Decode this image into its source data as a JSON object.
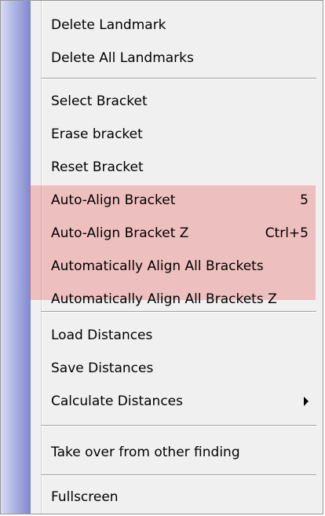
{
  "menu": {
    "items": [
      {
        "label": "Delete Landmark"
      },
      {
        "label": "Delete All Landmarks"
      },
      {
        "label": "Select Bracket"
      },
      {
        "label": "Erase bracket"
      },
      {
        "label": "Reset Bracket"
      },
      {
        "label": "Auto-Align Bracket",
        "shortcut": "5"
      },
      {
        "label": "Auto-Align Bracket Z",
        "shortcut": "Ctrl+5"
      },
      {
        "label": "Automatically Align All Brackets"
      },
      {
        "label": "Automatically Align All Brackets Z"
      },
      {
        "label": "Load Distances"
      },
      {
        "label": "Save Distances"
      },
      {
        "label": "Calculate Distances",
        "submenu": true
      },
      {
        "label": "Take over from other finding"
      },
      {
        "label": "Fullscreen"
      }
    ]
  },
  "colors": {
    "highlight": "#eb5a5a",
    "gutter_start": "#d9dcf2",
    "gutter_end": "#7f88cf"
  }
}
